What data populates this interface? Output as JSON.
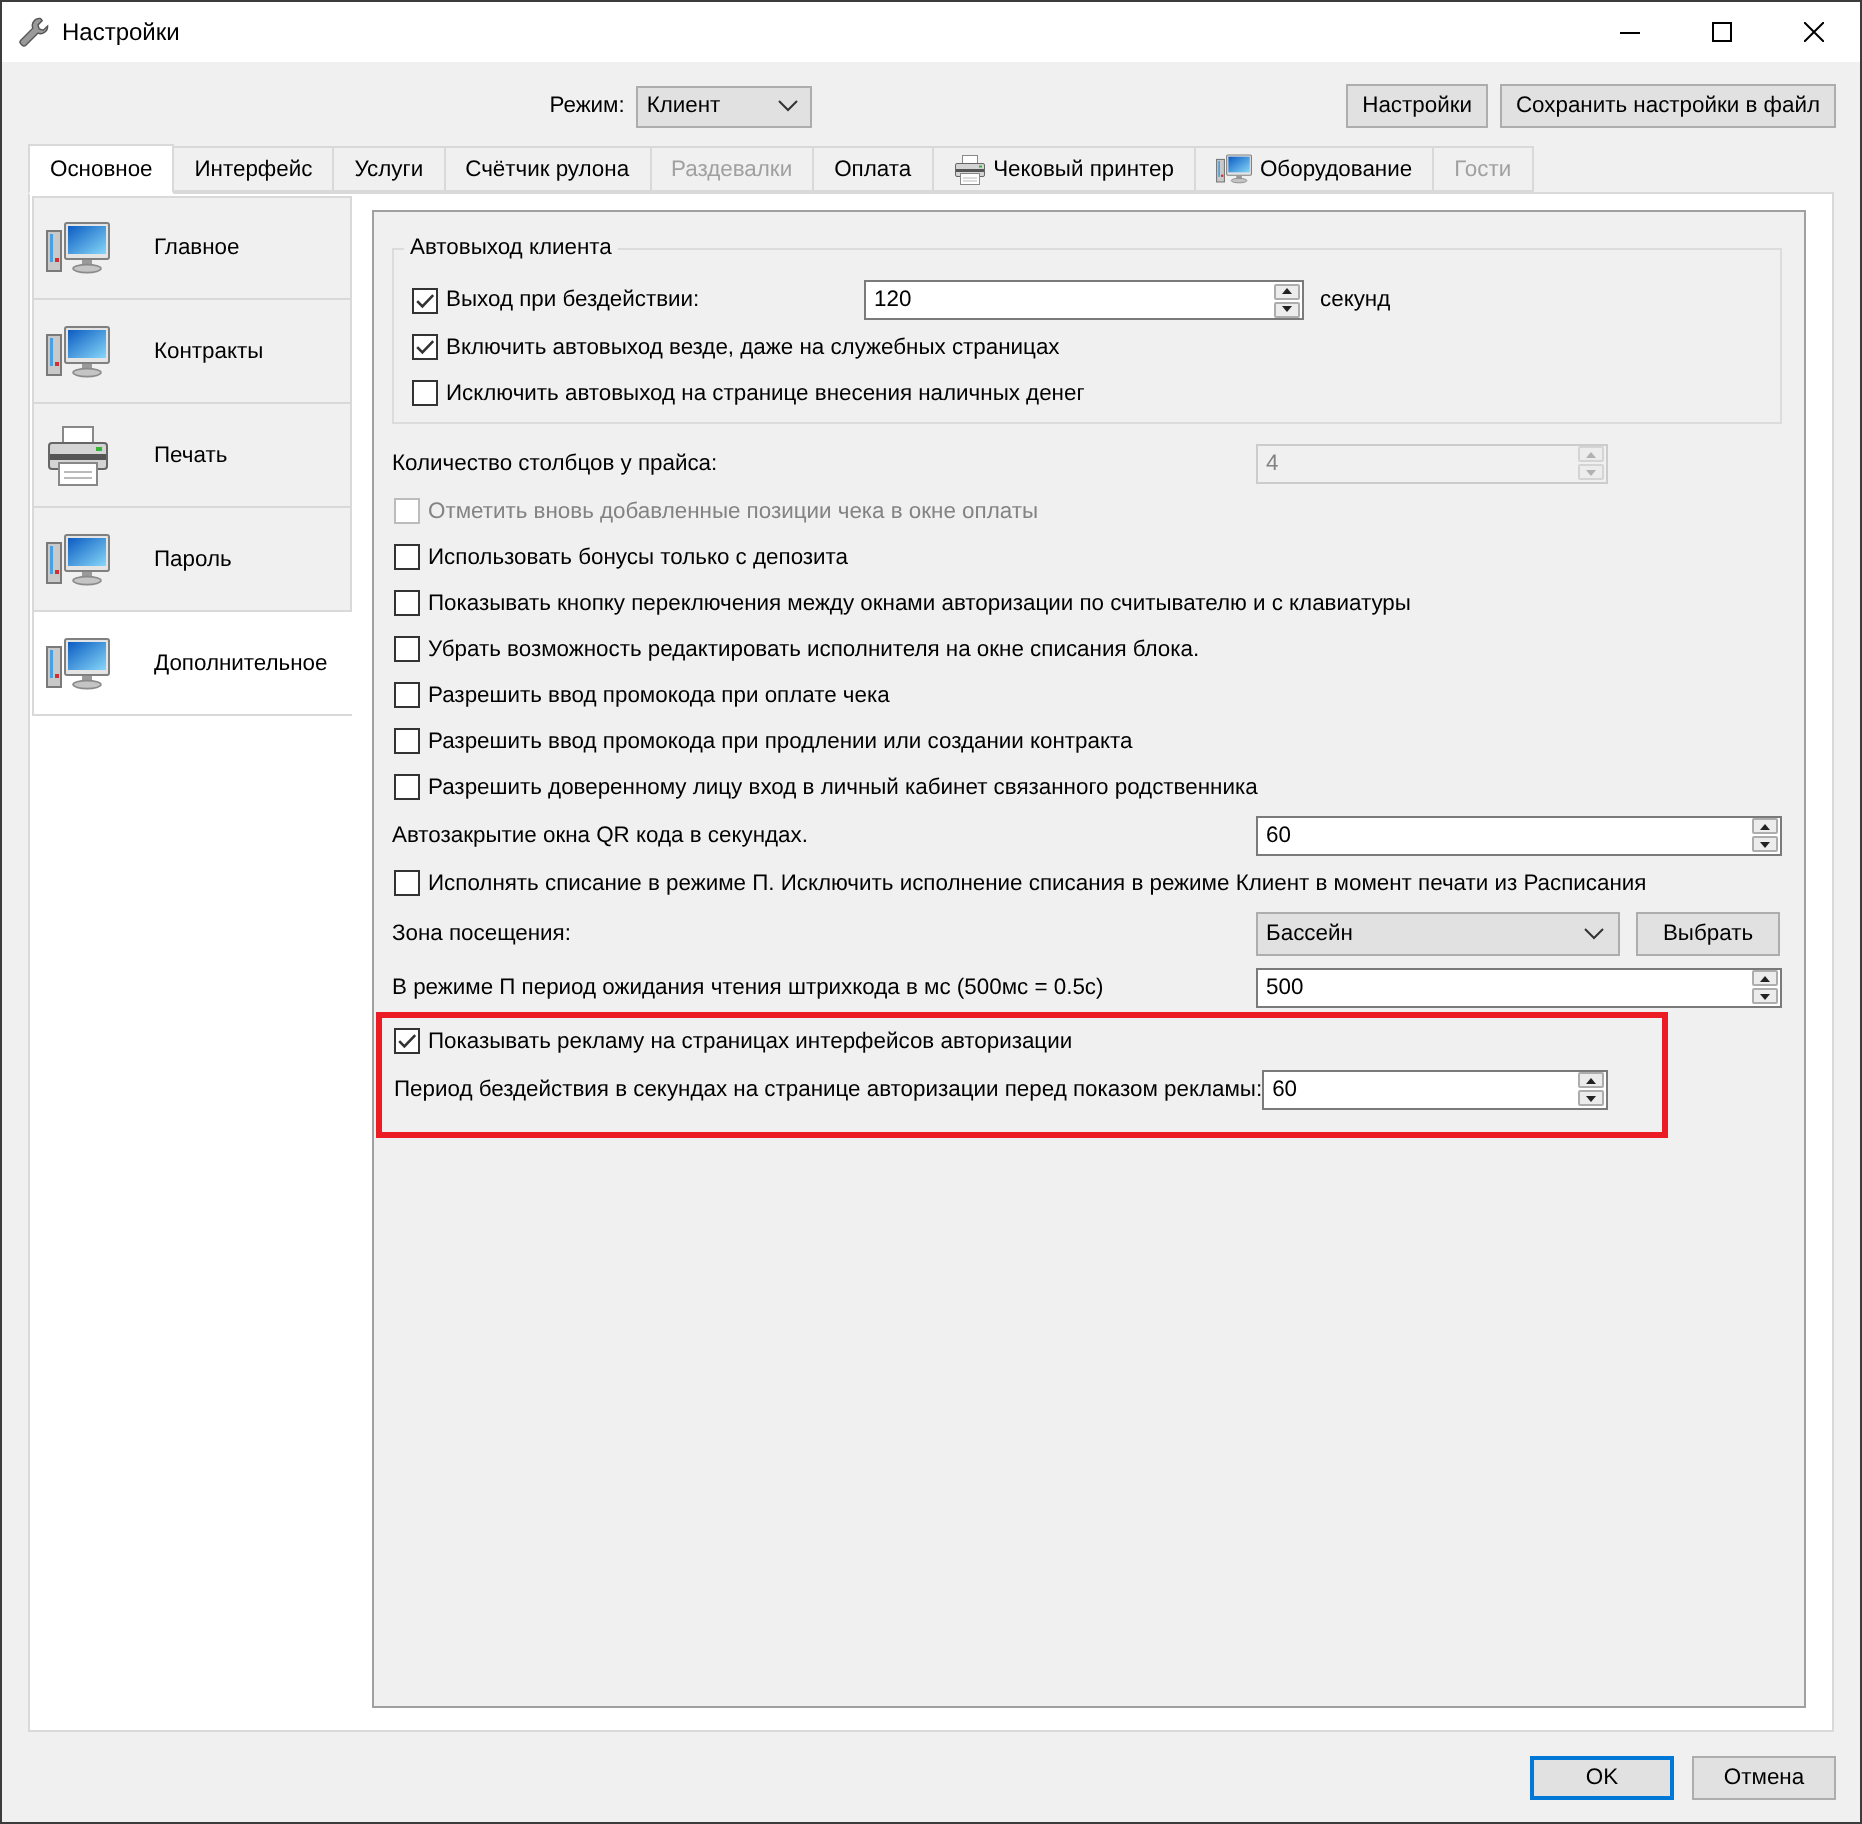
{
  "window": {
    "title": "Настройки"
  },
  "mode": {
    "label": "Режим:",
    "value": "Клиент"
  },
  "top_buttons": [
    "Настройки",
    "Сохранить настройки в файл"
  ],
  "tabs": [
    {
      "label": "Основное",
      "kind": "plain",
      "selected": true,
      "disabled": false
    },
    {
      "label": "Интерфейс",
      "kind": "plain",
      "selected": false,
      "disabled": false
    },
    {
      "label": "Услуги",
      "kind": "plain",
      "selected": false,
      "disabled": false
    },
    {
      "label": "Счётчик рулона",
      "kind": "plain",
      "selected": false,
      "disabled": false
    },
    {
      "label": "Раздевалки",
      "kind": "plain",
      "selected": false,
      "disabled": true
    },
    {
      "label": "Оплата",
      "kind": "plain",
      "selected": false,
      "disabled": false
    },
    {
      "label": "Чековый принтер",
      "kind": "printer",
      "selected": false,
      "disabled": false
    },
    {
      "label": "Оборудование",
      "kind": "computer",
      "selected": false,
      "disabled": false
    },
    {
      "label": "Гости",
      "kind": "plain",
      "selected": false,
      "disabled": true
    }
  ],
  "sidebar": {
    "items": [
      {
        "label": "Главное",
        "kind": "computer",
        "selected": false
      },
      {
        "label": "Контракты",
        "kind": "computer",
        "selected": false
      },
      {
        "label": "Печать",
        "kind": "printer",
        "selected": false
      },
      {
        "label": "Пароль",
        "kind": "computer",
        "selected": false
      },
      {
        "label": "Дополнительное",
        "kind": "computer",
        "selected": true
      }
    ]
  },
  "settings": {
    "group": {
      "title": "Автовыход клиента",
      "rows": [
        {
          "kind": "checkbox_spin",
          "label": "Выход при бездействии:",
          "checked": true,
          "value": "120",
          "unit": "секунд"
        },
        {
          "kind": "checkbox",
          "label": "Включить автовыход везде, даже на служебных страницах",
          "checked": true
        },
        {
          "kind": "checkbox",
          "label": "Исключить автовыход на странице внесения наличных денег",
          "checked": false
        }
      ]
    },
    "rows": [
      {
        "kind": "spin",
        "label": "Количество столбцов у прайса:",
        "value": "4",
        "disabled": true,
        "highlighted": false
      },
      {
        "kind": "checkbox",
        "label": "Отметить вновь добавленные позиции чека в окне оплаты",
        "checked": false,
        "disabled": true,
        "highlighted": false
      },
      {
        "kind": "checkbox",
        "label": "Использовать бонусы только с депозита",
        "checked": false,
        "disabled": false,
        "highlighted": false
      },
      {
        "kind": "checkbox",
        "label": "Показывать кнопку переключения между окнами авторизации по считывателю и с клавиатуры",
        "checked": false,
        "disabled": false,
        "highlighted": false
      },
      {
        "kind": "checkbox",
        "label": "Убрать возможность редактировать исполнителя на окне списания блока.",
        "checked": false,
        "disabled": false,
        "highlighted": false
      },
      {
        "kind": "checkbox",
        "label": "Разрешить ввод промокода при оплате чека",
        "checked": false,
        "disabled": false,
        "highlighted": false
      },
      {
        "kind": "checkbox",
        "label": "Разрешить ввод промокода при продлении или создании контракта",
        "checked": false,
        "disabled": false,
        "highlighted": false
      },
      {
        "kind": "checkbox",
        "label": "Разрешить доверенному лицу вход в личный кабинет связанного родственника",
        "checked": false,
        "disabled": false,
        "highlighted": false
      },
      {
        "kind": "spin",
        "label": "Автозакрытие окна QR кода в секундах.",
        "value": "60",
        "disabled": false,
        "highlighted": false
      },
      {
        "kind": "checkbox",
        "label": "Исполнять списание в режиме П. Исключить исполнение списания в режиме Клиент в момент печати из Расписания",
        "checked": false,
        "disabled": false,
        "highlighted": false
      },
      {
        "kind": "select",
        "label": "Зона посещения:",
        "value": "Бассейн",
        "button": "Выбрать",
        "disabled": false,
        "highlighted": false
      },
      {
        "kind": "spin",
        "label": "В режиме П период ожидания чтения штрихкода в мс (500мс = 0.5с)",
        "value": "500",
        "disabled": false,
        "highlighted": false
      },
      {
        "kind": "checkbox",
        "label": "Показывать рекламу на страницах интерфейсов авторизации",
        "checked": true,
        "disabled": false,
        "highlighted": true
      },
      {
        "kind": "spin",
        "label": "Период бездействия в секундах на странице авторизации перед показом рекламы:",
        "value": "60",
        "disabled": false,
        "highlighted": true
      }
    ]
  },
  "footer_buttons": [
    {
      "label": "OK",
      "default": true
    },
    {
      "label": "Отмена",
      "default": false
    }
  ]
}
